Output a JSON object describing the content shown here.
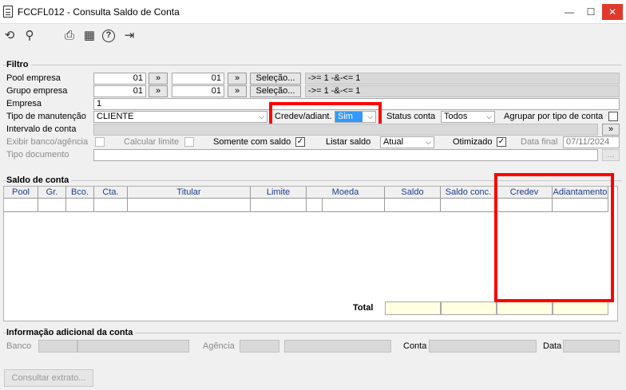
{
  "window": {
    "title": "FCCFL012 - Consulta Saldo de Conta",
    "minimize": "—",
    "maximize": "☐",
    "close": "✕"
  },
  "toolbar": {
    "refresh": "⟲",
    "search": "⚲",
    "print": "⎙",
    "calendar": "▦",
    "help": "?",
    "exit": "⇥"
  },
  "filtro": {
    "title": "Filtro",
    "pool_label": "Pool empresa",
    "pool_from": "01",
    "pool_to": "01",
    "pool_arrow": "»",
    "pool_selecao": "Seleção...",
    "pool_expr": "->= 1 -&-<= 1",
    "grupo_label": "Grupo empresa",
    "grupo_from": "01",
    "grupo_to": "01",
    "grupo_arrow": "»",
    "grupo_selecao": "Seleção...",
    "grupo_expr": "->= 1 -&-<= 1",
    "empresa_label": "Empresa",
    "empresa_value": "1",
    "tipo_label": "Tipo de manutenção",
    "tipo_value": "CLIENTE",
    "credev_label": "Credev/adiant.",
    "credev_value": "Sim",
    "status_label": "Status conta",
    "status_value": "Todos",
    "agrupar_label": "Agrupar por tipo de conta",
    "intervalo_label": "Intervalo de conta",
    "intervalo_arrow": "»",
    "exibir_label": "Exibir banco/agência",
    "calcular_label": "Calcular limite",
    "somente_label": "Somente com saldo",
    "listar_label": "Listar saldo",
    "listar_value": "Atual",
    "otimizado_label": "Otimizado",
    "data_final_label": "Data final",
    "data_final_value": "07/11/2024",
    "tipo_doc_label": "Tipo documento",
    "tipo_doc_button": "..."
  },
  "saldo": {
    "title": "Saldo de conta",
    "columns": [
      "Pool",
      "Gr.",
      "Bco.",
      "Cta.",
      "Titular",
      "Limite",
      "Moeda",
      "Saldo",
      "Saldo conc.",
      "Credev",
      "Adiantamento"
    ],
    "total_label": "Total"
  },
  "info": {
    "title": "Informação adicional da conta",
    "banco_label": "Banco",
    "agencia_label": "Agência",
    "conta_label": "Conta",
    "data_label": "Data"
  },
  "consultar_button": "Consultar extrato...",
  "colors": {
    "highlight_border": "#ff0000",
    "selected_bg": "#3399ff",
    "header_text": "#1c3c8c"
  },
  "checkboxes": {
    "agrupar": false,
    "exibir": false,
    "calcular": false,
    "somente": true,
    "otimizado": true
  }
}
